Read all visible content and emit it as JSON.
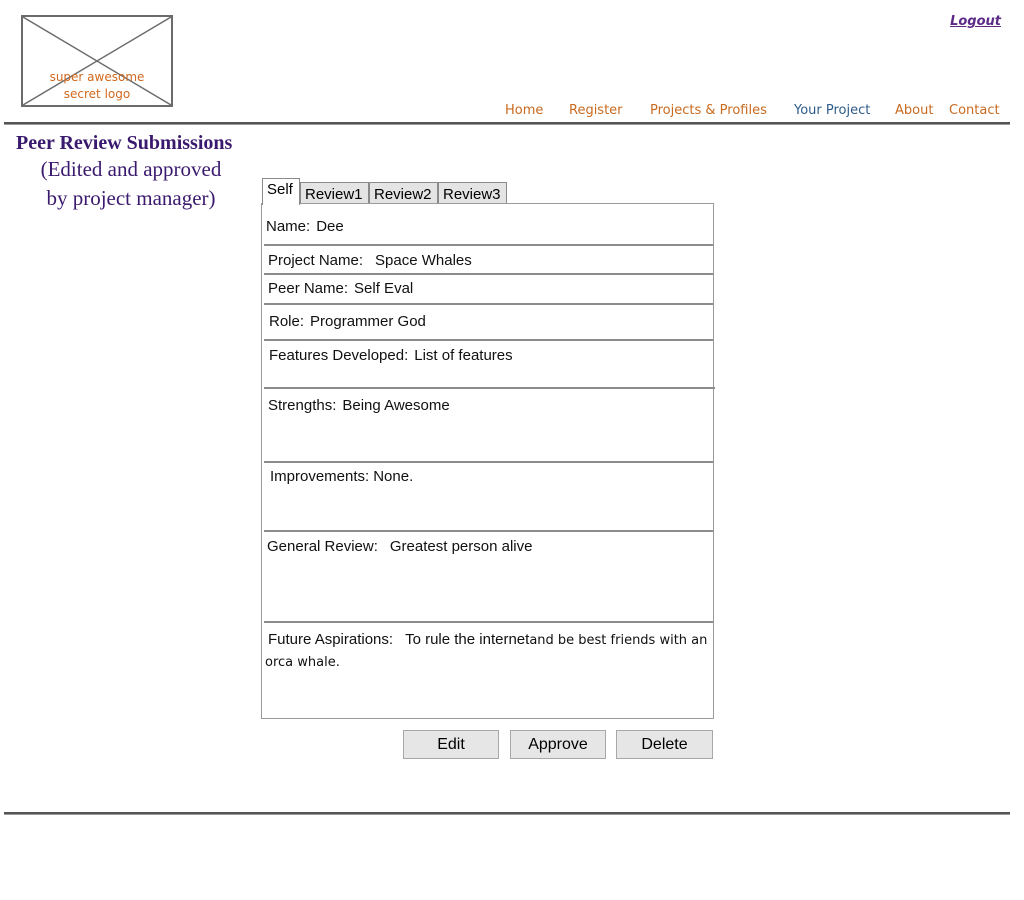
{
  "logo": {
    "line1": "super awesome",
    "line2": "secret logo"
  },
  "header": {
    "logout": "Logout"
  },
  "nav": {
    "items": [
      {
        "label": "Home"
      },
      {
        "label": "Register"
      },
      {
        "label": "Projects & Profiles"
      },
      {
        "label": "Your Project"
      },
      {
        "label": "About"
      },
      {
        "label": "Contact"
      }
    ],
    "active": "Your Project"
  },
  "page": {
    "title": "Peer Review Submissions",
    "subtitle_line1": "(Edited and approved",
    "subtitle_line2": "by project manager)"
  },
  "tabs": [
    "Self",
    "Review1",
    "Review2",
    "Review3"
  ],
  "review": {
    "name": {
      "label": "Name:",
      "value": "Dee"
    },
    "project_name": {
      "label": "Project Name:",
      "value": "Space Whales"
    },
    "peer_name": {
      "label": "Peer Name:",
      "value": "Self Eval"
    },
    "role": {
      "label": "Role:",
      "value": "Programmer God"
    },
    "features": {
      "label": "Features Developed:",
      "value": "List of features"
    },
    "strengths": {
      "label": "Strengths:",
      "value": "Being Awesome"
    },
    "improvements": {
      "label": "Improvements:",
      "value": "None."
    },
    "general_review": {
      "label": "General Review:",
      "value": "Greatest person alive"
    },
    "future": {
      "label": "Future Aspirations:",
      "value_part1": "To rule the internet",
      "value_part2": "and be best friends with an orca whale."
    }
  },
  "buttons": {
    "edit": "Edit",
    "approve": "Approve",
    "delete": "Delete"
  },
  "colors": {
    "nav": "#c96a1f",
    "nav_active": "#2e5c8a",
    "heading": "#3a1a6e"
  }
}
